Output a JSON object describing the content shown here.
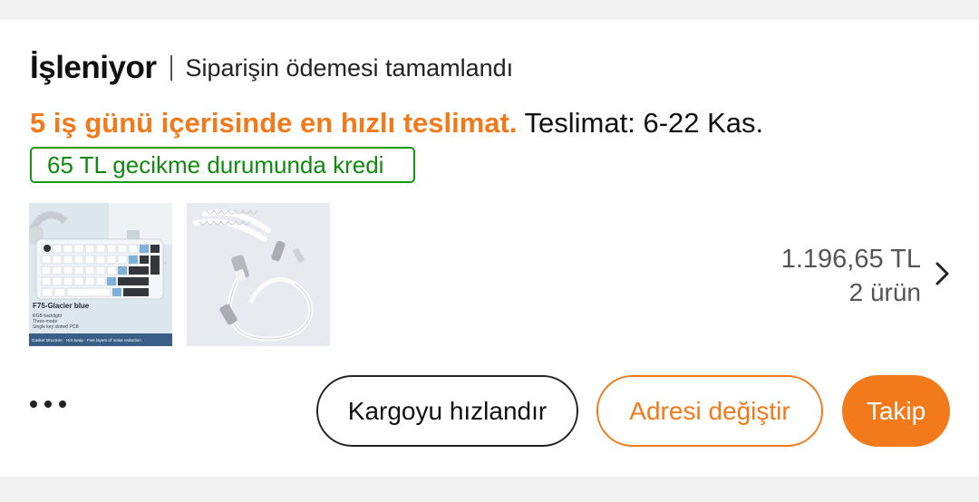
{
  "order": {
    "status": "İşleniyor",
    "status_desc": "Siparişin ödemesi tamamlandı",
    "delivery_fast": "5 iş günü içerisinde en hızlı teslimat.",
    "delivery_date": "Teslimat: 6-22 Kas.",
    "credit_badge": "65 TL gecikme durumunda kredi",
    "price": "1.196,65 TL",
    "item_count": "2 ürün"
  },
  "products": [
    {
      "name": "keyboard-thumbnail",
      "title": "F75-Glacier blue",
      "lines": [
        "RGB backlight",
        "Three-mode",
        "Single key slotted PCB"
      ],
      "strip": "Gasket structure · Hot swap · Five layers of noise reduction"
    },
    {
      "name": "coiled-cable-thumbnail"
    }
  ],
  "actions": {
    "cargo": "Kargoyu hızlandır",
    "address": "Adresi değiştir",
    "track": "Takip"
  },
  "colors": {
    "accent": "#f27a1a",
    "green": "#0f8a0f"
  },
  "icons": {
    "more": "more-dots-icon",
    "chevron": "chevron-right-icon"
  }
}
